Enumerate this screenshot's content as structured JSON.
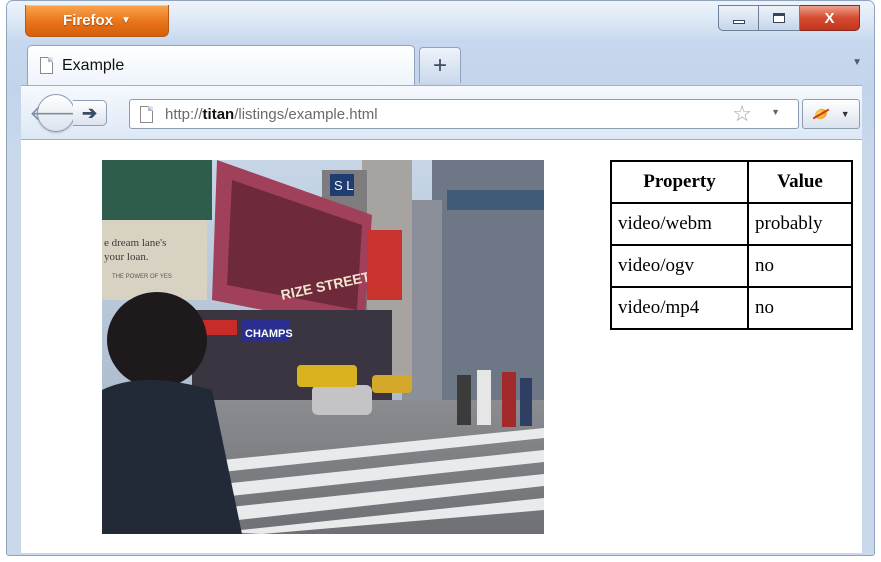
{
  "window": {
    "app_button_label": "Firefox",
    "close_label": "X"
  },
  "tabs": [
    {
      "label": "Example"
    }
  ],
  "newtab_label": "+",
  "navbar": {
    "url_prefix": "http://",
    "url_host": "titan",
    "url_path": "/listings/example.html"
  },
  "content": {
    "table": {
      "headers": [
        "Property",
        "Value"
      ],
      "rows": [
        [
          "video/webm",
          "probably"
        ],
        [
          "video/ogv",
          "no"
        ],
        [
          "video/mp4",
          "no"
        ]
      ]
    },
    "video": {
      "billboard_text": "RIZE STREET",
      "store_sign": "CHAMPS",
      "left_sign_line1": "e dream lane's",
      "left_sign_line2": "your loan.",
      "left_sign_line3": "THE POWER OF YES",
      "top_sign": "S L"
    }
  },
  "icons": {
    "back": "back-arrow-icon",
    "forward": "forward-arrow-icon",
    "page": "page-icon",
    "bookmark": "star-icon",
    "addon": "bug-icon"
  },
  "colors": {
    "firefox_orange": "#e8731a",
    "close_red": "#d44a2f",
    "frame_blue": "#c7d8ee"
  }
}
